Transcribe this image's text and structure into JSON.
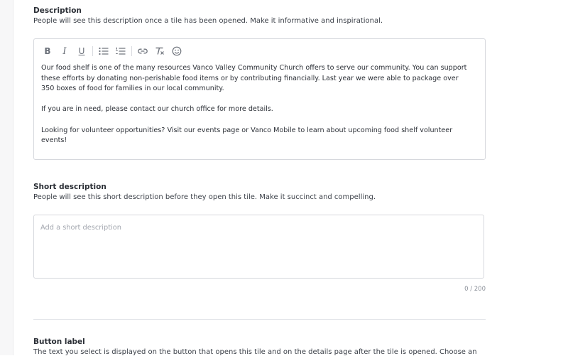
{
  "description": {
    "title": "Description",
    "help": "People will see this description once a tile has been opened. Make it informative and inspirational.",
    "toolbar": {
      "bold": "B",
      "italic": "I",
      "underline": "U",
      "icons": [
        "bulleted-list-icon",
        "numbered-list-icon",
        "link-icon",
        "clear-format-icon",
        "emoji-icon"
      ]
    },
    "paragraphs": [
      "Our food shelf is one of the many resources Vanco Valley Community Church offers to serve our community. You can support these efforts by donating non-perishable food items or by contributing financially. Last year we were able to package over 350 boxes of food for families in our local community.",
      "If you are in need, please contact our church office for more details.",
      "Looking for volunteer opportunities? Visit our events page or Vanco Mobile to learn about upcoming food shelf volunteer events!"
    ]
  },
  "short_description": {
    "title": "Short description",
    "help": "People will see this short description before they open this tile. Make it succinct and compelling.",
    "placeholder": "Add a short description",
    "value": "",
    "counter": "0 / 200"
  },
  "button_label": {
    "title": "Button label",
    "help": "The text you select is displayed on the button that opens this tile and on the details page after the tile is opened. Choose an"
  },
  "colors": {
    "border": "#d6d8dd",
    "text": "#2b2f36",
    "muted": "#8b9099"
  }
}
